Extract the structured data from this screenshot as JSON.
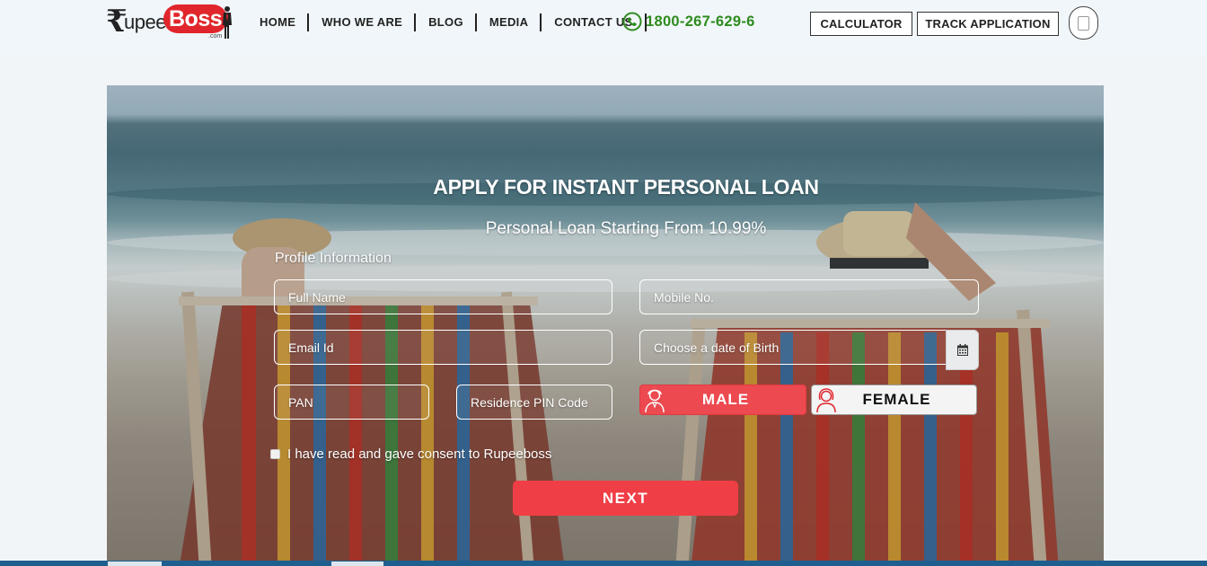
{
  "brand": {
    "rupee_symbol": "₹",
    "name_part1": "upee",
    "name_part2": "Boss",
    "domain_suffix": ".com"
  },
  "nav": {
    "items": [
      "HOME",
      "WHO WE ARE",
      "BLOG",
      "MEDIA",
      "CONTACT US"
    ]
  },
  "phone": {
    "number": "1800-267-629-6",
    "icon": "phone-icon",
    "color": "#2e8b1e"
  },
  "header_buttons": {
    "calculator": "CALCULATOR",
    "track": "TRACK APPLICATION"
  },
  "hero": {
    "title": "APPLY FOR INSTANT PERSONAL LOAN",
    "subtitle": "Personal Loan Starting From 10.99%",
    "section_label": "Profile Information"
  },
  "form": {
    "full_name": {
      "placeholder": "Full Name"
    },
    "mobile": {
      "placeholder": "Mobile No."
    },
    "email": {
      "placeholder": "Email Id"
    },
    "dob": {
      "placeholder": "Choose a date of Birth"
    },
    "pan": {
      "placeholder": "PAN"
    },
    "pin": {
      "placeholder": "Residence PIN Code"
    },
    "gender": {
      "male": "MALE",
      "female": "FEMALE",
      "selected": "MALE"
    },
    "consent_text": "I have read and gave consent to Rupeeboss",
    "next_label": "NEXT"
  },
  "colors": {
    "accent": "#ef3e46",
    "brand_red": "#e0262c",
    "phone_green": "#2e8b1e"
  }
}
